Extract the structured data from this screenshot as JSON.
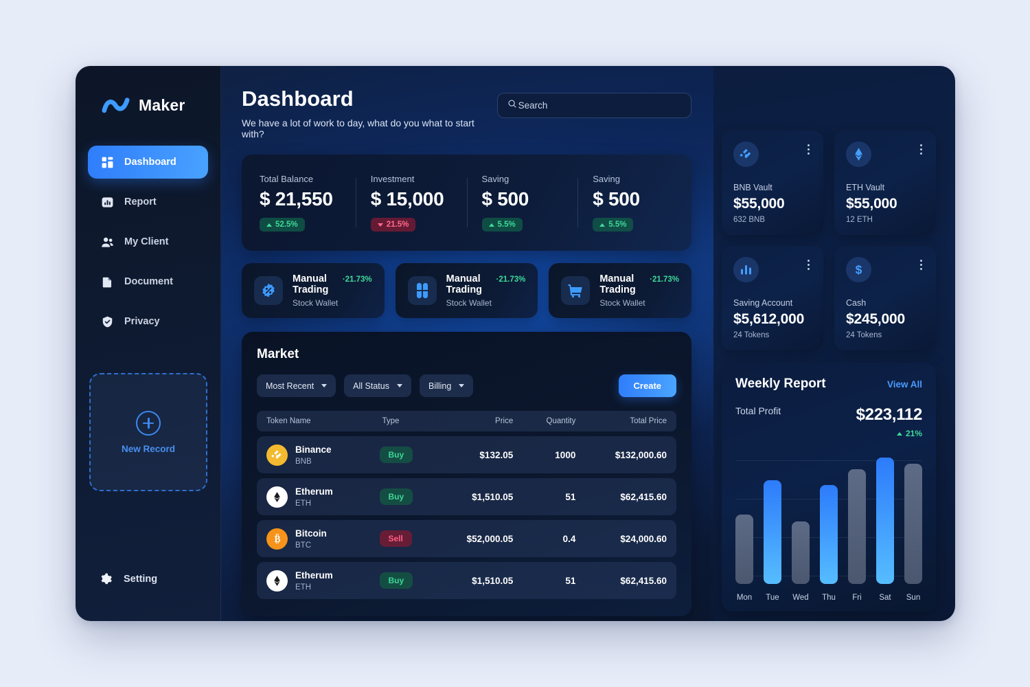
{
  "brand": {
    "name": "Maker",
    "logo_icon": "wave-logo-icon"
  },
  "sidebar": {
    "items": [
      {
        "label": "Dashboard",
        "icon": "grid-icon",
        "active": true
      },
      {
        "label": "Report",
        "icon": "bar-chart-icon",
        "active": false
      },
      {
        "label": "My Client",
        "icon": "users-icon",
        "active": false
      },
      {
        "label": "Document",
        "icon": "document-icon",
        "active": false
      },
      {
        "label": "Privacy",
        "icon": "shield-check-icon",
        "active": false
      }
    ],
    "new_record": {
      "label": "New Record",
      "icon": "plus-circle-icon"
    },
    "setting": {
      "label": "Setting",
      "icon": "gear-icon"
    }
  },
  "header": {
    "title": "Dashboard",
    "subtitle": "We have a lot of work to day, what do you what to start with?"
  },
  "search": {
    "placeholder": "Search",
    "value": "Search",
    "icon": "search-icon"
  },
  "stats": [
    {
      "label": "Total Balance",
      "value": "$ 21,550",
      "delta": "52.5%",
      "direction": "up"
    },
    {
      "label": "Investment",
      "value": "$ 15,000",
      "delta": "21.5%",
      "direction": "down"
    },
    {
      "label": "Saving",
      "value": "$ 500",
      "delta": "5.5%",
      "direction": "up"
    },
    {
      "label": "Saving",
      "value": "$ 500",
      "delta": "5.5%",
      "direction": "up"
    }
  ],
  "trading_cards": [
    {
      "title": "Manual Trading",
      "pct": "·21.73%",
      "sub": "Stock Wallet",
      "icon": "percent-badge-icon"
    },
    {
      "title": "Manual Trading",
      "pct": "·21.73%",
      "sub": "Stock Wallet",
      "icon": "clover-blocks-icon"
    },
    {
      "title": "Manual Trading",
      "pct": "·21.73%",
      "sub": "Stock Wallet",
      "icon": "shopping-cart-icon"
    }
  ],
  "market": {
    "title": "Market",
    "filters": [
      {
        "label": "Most Recent"
      },
      {
        "label": "All Status"
      },
      {
        "label": "Billing"
      }
    ],
    "create_label": "Create",
    "columns": [
      "Token Name",
      "Type",
      "Price",
      "Quantity",
      "Total Price"
    ],
    "rows": [
      {
        "name": "Binance",
        "symbol": "BNB",
        "logo": "binance-logo-icon",
        "type": "Buy",
        "price": "$132.05",
        "quantity": "1000",
        "total": "$132,000.60"
      },
      {
        "name": "Etherum",
        "symbol": "ETH",
        "logo": "ethereum-logo-icon",
        "type": "Buy",
        "price": "$1,510.05",
        "quantity": "51",
        "total": "$62,415.60"
      },
      {
        "name": "Bitcoin",
        "symbol": "BTC",
        "logo": "bitcoin-logo-icon",
        "type": "Sell",
        "price": "$52,000.05",
        "quantity": "0.4",
        "total": "$24,000.60"
      },
      {
        "name": "Etherum",
        "symbol": "ETH",
        "logo": "ethereum-logo-icon",
        "type": "Buy",
        "price": "$1,510.05",
        "quantity": "51",
        "total": "$62,415.60"
      }
    ]
  },
  "vaults": [
    {
      "name": "BNB Vault",
      "value": "$55,000",
      "sub": "632 BNB",
      "icon": "binance-logo-icon"
    },
    {
      "name": "ETH Vault",
      "value": "$55,000",
      "sub": "12 ETH",
      "icon": "ethereum-logo-icon"
    },
    {
      "name": "Saving Account",
      "value": "$5,612,000",
      "sub": "24 Tokens",
      "icon": "bar-chart-icon"
    },
    {
      "name": "Cash",
      "value": "$245,000",
      "sub": "24 Tokens",
      "icon": "dollar-icon"
    }
  ],
  "weekly_report": {
    "title": "Weekly Report",
    "view_all_label": "View All",
    "profit_label": "Total Profit",
    "profit_value": "$223,112",
    "delta": "21%",
    "delta_direction": "up"
  },
  "chart_data": {
    "type": "bar",
    "title": "Weekly Report",
    "categories": [
      "Mon",
      "Tue",
      "Wed",
      "Thu",
      "Fri",
      "Sat",
      "Sun"
    ],
    "values": [
      52,
      78,
      47,
      74,
      86,
      95,
      90
    ],
    "highlighted": [
      "Tue",
      "Thu",
      "Sat"
    ],
    "xlabel": "",
    "ylabel": "",
    "ylim": [
      0,
      100
    ],
    "grid": true,
    "legend": "none",
    "colors": {
      "accent": "#2d7bfb",
      "accent_light": "#56bdff",
      "muted": "#5e6b86"
    }
  },
  "colors": {
    "page_background": "#e7ecf9",
    "sidebar": "#0d1628",
    "accent_blue": "#2f7dfb",
    "accent_blue_light": "#4ba5ff",
    "positive_green": "#3fd99a",
    "negative_red": "#ff6b8e",
    "binance_yellow": "#f3ba2f",
    "bitcoin_orange": "#f7931a"
  }
}
